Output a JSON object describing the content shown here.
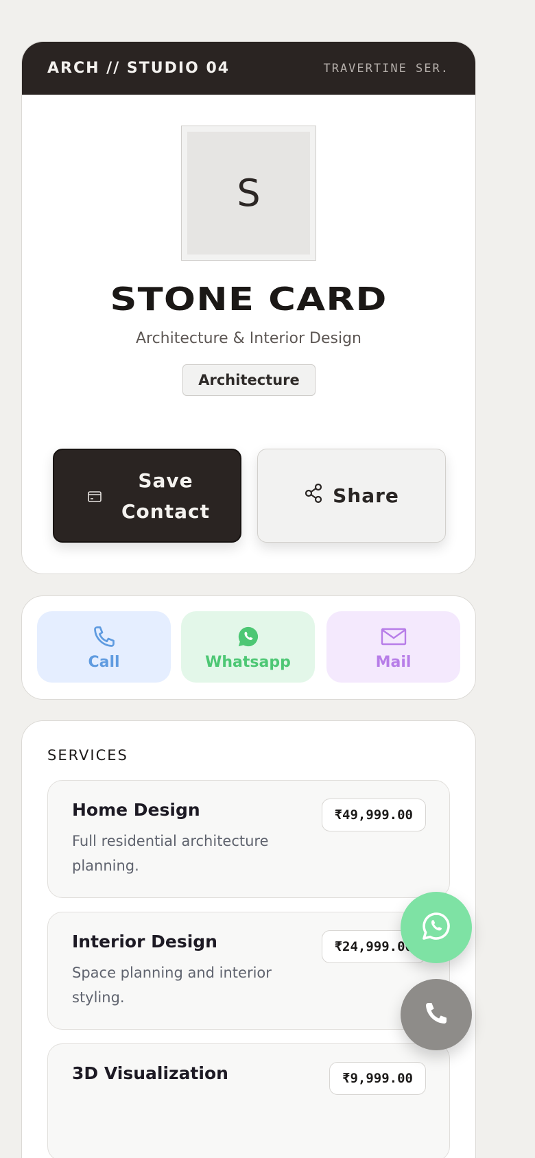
{
  "header": {
    "brand": "ARCH // STUDIO 04",
    "series": "TRAVERTINE SER."
  },
  "profile": {
    "avatar_initial": "S",
    "name": "STONE CARD",
    "subtitle": "Architecture & Interior Design",
    "tag": "Architecture"
  },
  "buttons": {
    "save_line1": "Save",
    "save_line2": "Contact",
    "share": "Share",
    "save_icon": "contact-card-icon",
    "share_icon": "share-icon"
  },
  "quick_actions": [
    {
      "label": "Call",
      "icon": "phone-icon",
      "color": "#5f9be0"
    },
    {
      "label": "Whatsapp",
      "icon": "whatsapp-icon",
      "color": "#4dc774"
    },
    {
      "label": "Mail",
      "icon": "mail-icon",
      "color": "#b77de8"
    }
  ],
  "services": {
    "heading": "SERVICES",
    "items": [
      {
        "name": "Home Design",
        "desc": "Full residential architecture planning.",
        "price": "₹49,999.00"
      },
      {
        "name": "Interior Design",
        "desc": "Space planning and interior styling.",
        "price": "₹24,999.00"
      },
      {
        "name": "3D Visualization",
        "desc": "",
        "price": "₹9,999.00"
      }
    ]
  },
  "floating": {
    "whatsapp_icon": "whatsapp-icon",
    "call_icon": "phone-icon"
  },
  "colors": {
    "header_bg": "#2a2422",
    "page_bg": "#f1f0ed",
    "whatsapp_fab": "#7ee2a4",
    "call_fab": "#8e8c89"
  }
}
